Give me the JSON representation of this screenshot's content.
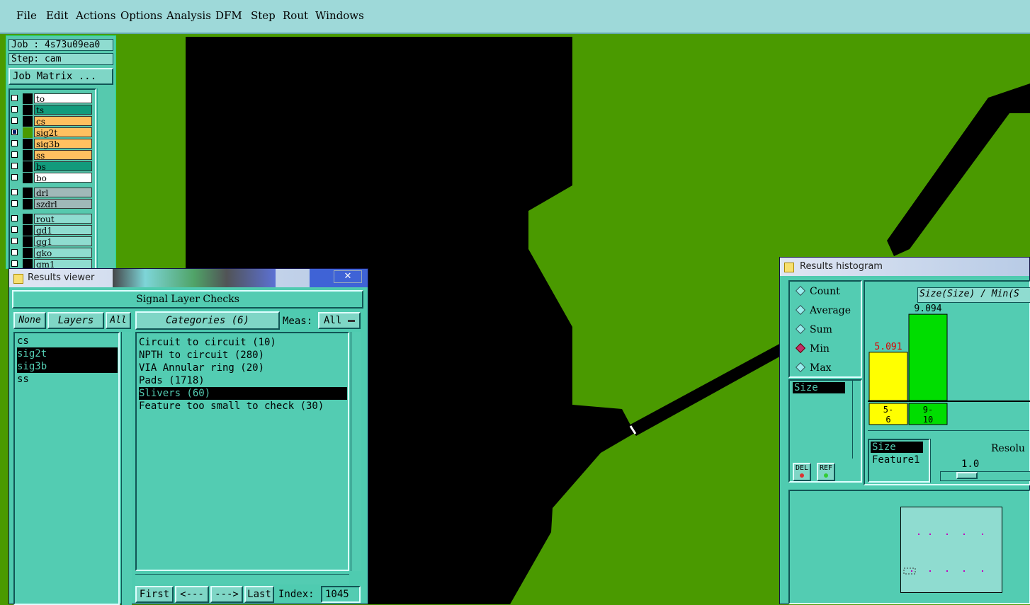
{
  "menubar": {
    "items": [
      "File",
      "Edit",
      "Actions",
      "Options",
      "Analysis",
      "DFM",
      "Step",
      "Rout",
      "Windows"
    ]
  },
  "job": {
    "job_label": "Job : 4s73u09ea0",
    "step_label": "Step: cam",
    "job_matrix_button": "Job Matrix ..."
  },
  "layers": [
    {
      "name": "to",
      "bg": "#ffffff",
      "chip": "#000000",
      "selected": false
    },
    {
      "name": "ts",
      "bg": "#129b7c",
      "chip": "#000000",
      "selected": false
    },
    {
      "name": "cs",
      "bg": "#ffc060",
      "chip": "#000000",
      "selected": false
    },
    {
      "name": "sig2t",
      "bg": "#ffc060",
      "chip": "#4a9a00",
      "selected": true,
      "mark": "⊞"
    },
    {
      "name": "sig3b",
      "bg": "#ffc060",
      "chip": "#000000",
      "selected": false
    },
    {
      "name": "ss",
      "bg": "#ffc060",
      "chip": "#000000",
      "selected": false
    },
    {
      "name": "bs",
      "bg": "#129b7c",
      "chip": "#000000",
      "selected": false
    },
    {
      "name": "bo",
      "bg": "#ffffff",
      "chip": "#000000",
      "selected": false
    },
    {
      "name": "drl",
      "bg": "#a0b8b8",
      "chip": "#000000",
      "selected": false
    },
    {
      "name": "szdrl",
      "bg": "#a0b8b8",
      "chip": "#000000",
      "selected": false
    },
    {
      "name": "rout",
      "bg": "#8fdcd0",
      "chip": "#000000",
      "selected": false
    },
    {
      "name": "gd1",
      "bg": "#8fdcd0",
      "chip": "#000000",
      "selected": false,
      "mark": "✎"
    },
    {
      "name": "gg1",
      "bg": "#8fdcd0",
      "chip": "#000000",
      "selected": false
    },
    {
      "name": "gko",
      "bg": "#8fdcd0",
      "chip": "#000000",
      "selected": false,
      "mark": "✎"
    },
    {
      "name": "gm1",
      "bg": "#8fdcd0",
      "chip": "#000000",
      "selected": false,
      "mark": "✎"
    }
  ],
  "results_viewer": {
    "title": "Results viewer",
    "close_glyph": "✕",
    "header": "Signal Layer Checks",
    "none_button": "None",
    "layers_button": "Layers",
    "all_button": "All",
    "layers_list": [
      "cs",
      "sig2t",
      "sig3b",
      "ss"
    ],
    "layers_selected": [
      1,
      2
    ],
    "categories_button": "Categories (6)",
    "meas_label": "Meas:",
    "meas_value": "All",
    "categories": [
      "Circuit to circuit (10)",
      "NPTH to circuit (280)",
      "VIA Annular ring (20)",
      "Pads (1718)",
      "Slivers (60)",
      "Feature too small to check (30)"
    ],
    "category_selected": 4,
    "first_button": "First",
    "prev_button": "<---",
    "next_button": "--->",
    "last_button": "Last",
    "index_label": "Index:",
    "index_value": "1045"
  },
  "results_histogram": {
    "title": "Results histogram",
    "modes": [
      "Count",
      "Average",
      "Sum",
      "Min",
      "Max"
    ],
    "mode_selected": 3,
    "attr_list": [
      "Size"
    ],
    "del_button": "DEL",
    "ref_button": "REF",
    "chart_title": "Size(Size) / Min(S",
    "attr_list2": [
      "Size",
      "Feature1"
    ],
    "resolution_label": "Resolu",
    "resolution_value": "1.0",
    "chart_data": {
      "type": "bar",
      "categories": [
        "5-6",
        "9-10"
      ],
      "values": [
        5.091,
        9.094
      ],
      "value_labels": [
        "5.091",
        "9.094"
      ],
      "colors": [
        "#ffff00",
        "#00dd00"
      ],
      "label_colors": [
        "#dd0000",
        "#000000"
      ],
      "bin_labels": [
        [
          "5-",
          "6"
        ],
        [
          "9-",
          "10"
        ]
      ]
    }
  }
}
